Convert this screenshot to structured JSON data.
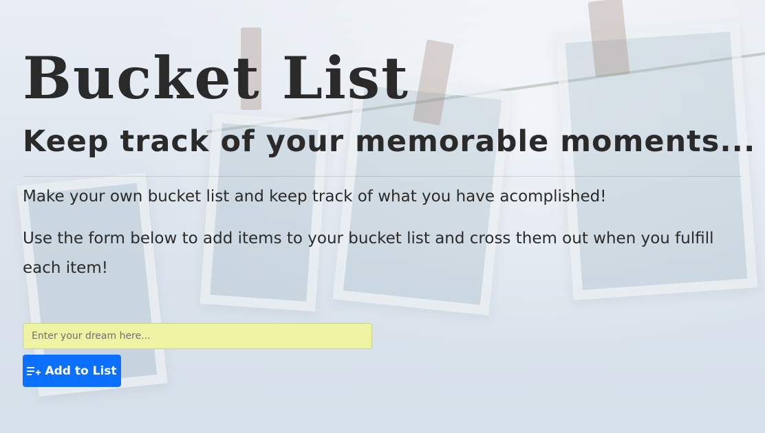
{
  "page": {
    "title": "Bucket List",
    "subtitle": "Keep track of your memorable moments...",
    "intro_line_1": "Make your own bucket list and keep track of what you have acomplished!",
    "intro_line_2": "Use the form below to add items to your bucket list and cross them out when you fulfill each item!"
  },
  "form": {
    "input_placeholder": "Enter your dream here...",
    "input_value": "",
    "add_button_label": "Add to List",
    "add_button_icon": "playlist-add-icon"
  },
  "colors": {
    "button_bg": "#0b6fff",
    "input_bg": "#eef3a3",
    "text": "#2a2a2a"
  }
}
